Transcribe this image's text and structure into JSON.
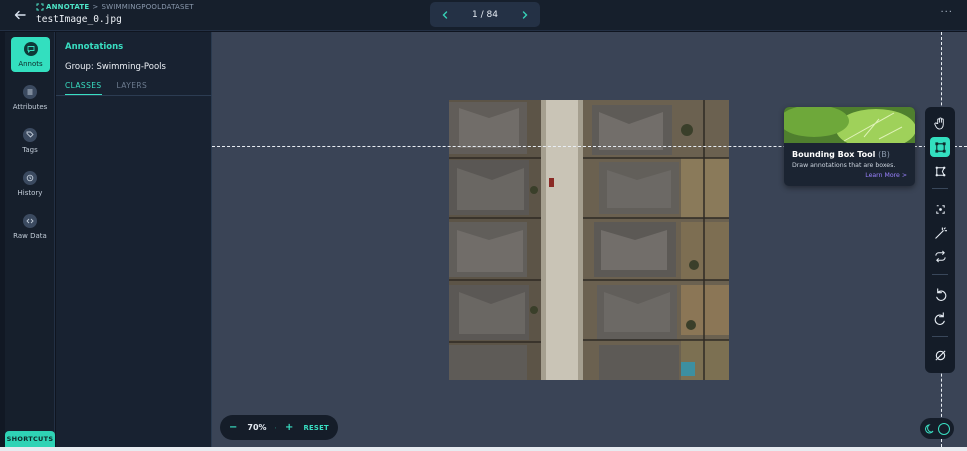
{
  "header": {
    "breadcrumb_root": "ANNOTATE",
    "breadcrumb_sep": ">",
    "breadcrumb_dataset": "SWIMMINGPOOLDATASET",
    "filename": "testImage_0.jpg",
    "pager": "1 / 84",
    "more": "···"
  },
  "rail": {
    "items": [
      {
        "label": "Annots",
        "icon": "comment-icon",
        "active": true
      },
      {
        "label": "Attributes",
        "icon": "list-icon"
      },
      {
        "label": "Tags",
        "icon": "tag-icon"
      },
      {
        "label": "History",
        "icon": "history-icon"
      },
      {
        "label": "Raw Data",
        "icon": "code-icon"
      }
    ],
    "shortcuts": "SHORTCUTS"
  },
  "panel": {
    "title": "Annotations",
    "group": "Group: Swimming-Pools",
    "tabs": [
      {
        "label": "CLASSES",
        "active": true
      },
      {
        "label": "LAYERS",
        "active": false
      }
    ]
  },
  "tooltip": {
    "title": "Bounding Box Tool",
    "shortcut": "(B)",
    "description": "Draw annotations that are boxes.",
    "link": "Learn More >"
  },
  "tools": [
    "hand-icon",
    "bounding-box-icon",
    "polygon-icon",
    "smart-select-icon",
    "magic-wand-icon",
    "repeat-icon",
    "undo-icon",
    "redo-icon",
    "null-icon"
  ],
  "zoom": {
    "minus": "−",
    "level": "70%",
    "plus": "+",
    "reset": "RESET"
  },
  "colors": {
    "accent": "#33dfbf",
    "link": "#9a82ff",
    "canvas": "#3a4456"
  }
}
